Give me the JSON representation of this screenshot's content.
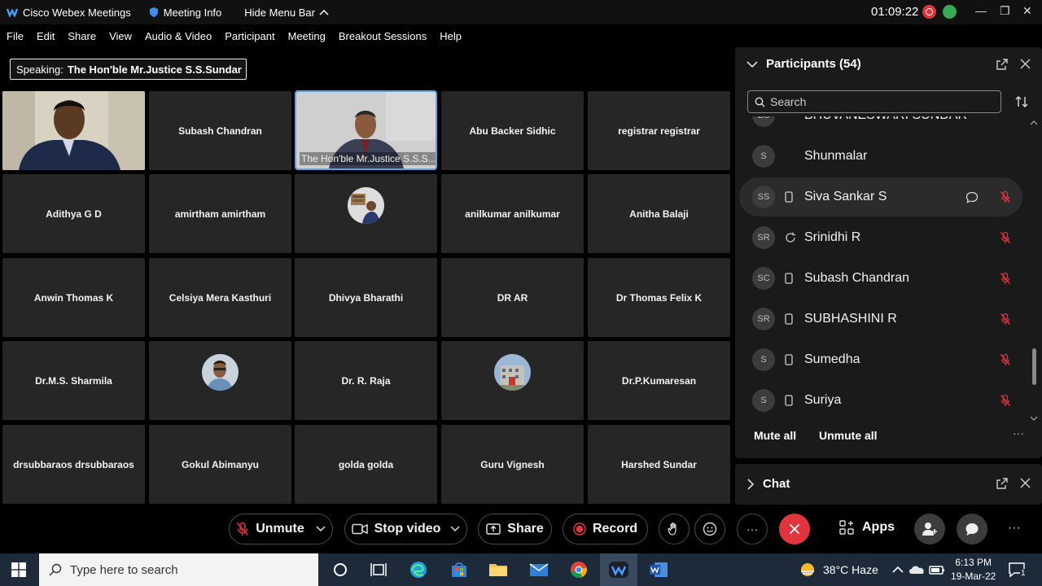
{
  "titlebar": {
    "app_title": "Cisco Webex Meetings",
    "meeting_info": "Meeting Info",
    "hide_menu": "Hide Menu Bar",
    "timer": "01:09:22",
    "minimize": "—",
    "restore": "❐",
    "close": "✕"
  },
  "menu": [
    "File",
    "Edit",
    "Share",
    "View",
    "Audio & Video",
    "Participant",
    "Meeting",
    "Breakout Sessions",
    "Help"
  ],
  "speaking": {
    "label": "Speaking:",
    "name": "The Hon'ble Mr.Justice S.S.Sundar"
  },
  "grid": [
    [
      "",
      "Subash Chandran",
      "The Hon'ble Mr.Justice S.S.S...",
      "Abu Backer Sidhic",
      "registrar registrar"
    ],
    [
      "Adithya G D",
      "amirtham amirtham",
      "",
      "anilkumar anilkumar",
      "Anitha Balaji"
    ],
    [
      "Anwin Thomas K",
      "Celsiya Mera Kasthuri",
      "Dhivya Bharathi",
      "DR AR",
      "Dr Thomas Felix K"
    ],
    [
      "Dr.M.S. Sharmila",
      "",
      "Dr. R. Raja",
      "",
      "Dr.P.Kumaresan"
    ],
    [
      "drsubbaraos drsubbaraos",
      "Gokul Abimanyu",
      "golda golda",
      "Guru Vignesh",
      "Harshed Sundar"
    ]
  ],
  "participants": {
    "title": "Participants (54)",
    "search_placeholder": "Search",
    "rows": [
      {
        "initials": "S",
        "name": "Shunmalar",
        "device": ""
      },
      {
        "initials": "SS",
        "name": "Siva Sankar S",
        "device": "phone"
      },
      {
        "initials": "SR",
        "name": "Srinidhi R",
        "device": "sync"
      },
      {
        "initials": "SC",
        "name": "Subash Chandran",
        "device": "phone"
      },
      {
        "initials": "SR",
        "name": "SUBHASHINI R",
        "device": "phone"
      },
      {
        "initials": "S",
        "name": "Sumedha",
        "device": "phone"
      },
      {
        "initials": "S",
        "name": "Suriya",
        "device": "phone"
      }
    ],
    "partial_row": "BHUVANESWARI SUNDAR",
    "partial_initials": "BS",
    "mute_all": "Mute all",
    "unmute_all": "Unmute all",
    "more": "···"
  },
  "chat": {
    "title": "Chat"
  },
  "controls": {
    "unmute": "Unmute",
    "stop_video": "Stop video",
    "share": "Share",
    "record": "Record",
    "more": "···",
    "apps": "Apps",
    "overflow": "···"
  },
  "taskbar": {
    "search_placeholder": "Type here to search",
    "weather": "38°C  Haze",
    "time": "6:13 PM",
    "date": "19-Mar-22",
    "notif_count": "1"
  },
  "colors": {
    "accent_blue": "#5ba3f0",
    "leave_red": "#e0343e",
    "record_red": "#d9363e",
    "stats_green": "#3aa757"
  }
}
